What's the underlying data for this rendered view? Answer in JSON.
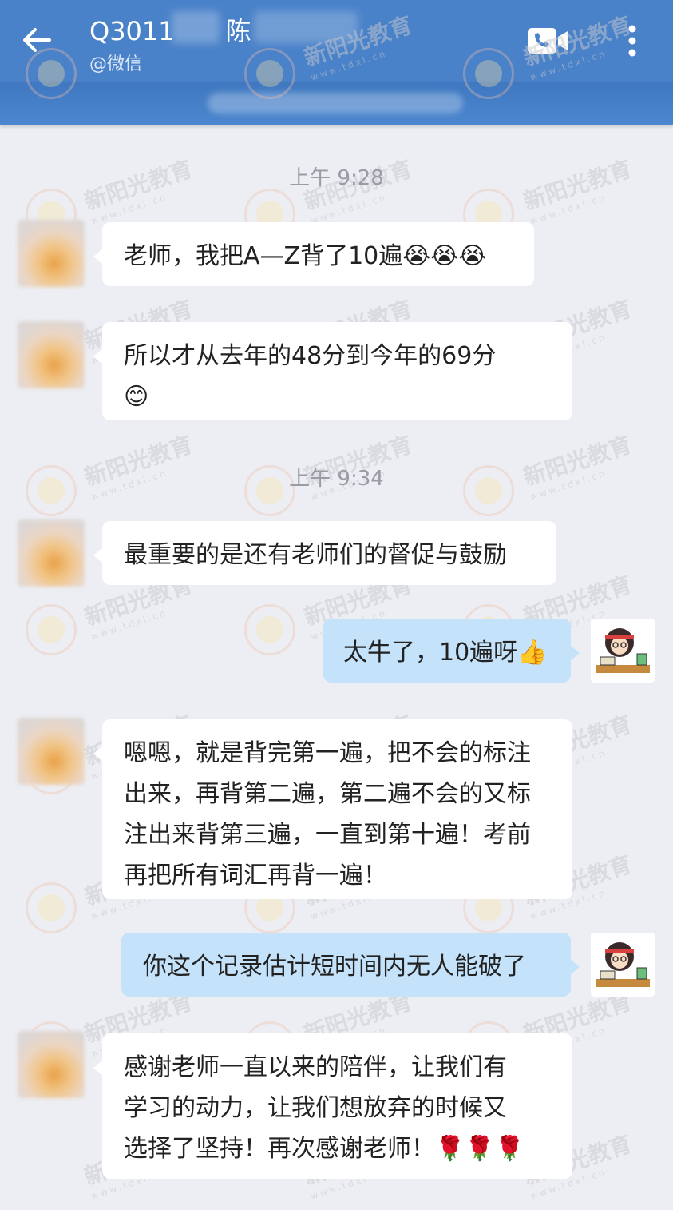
{
  "header": {
    "title": "Q3011",
    "title_suffix": "陈",
    "subtitle": "@微信",
    "back_icon": "arrow-left-icon",
    "call_icon": "video-call-icon",
    "menu_icon": "more-vertical-icon",
    "color": "#4a82c9"
  },
  "watermark": {
    "brand": "新阳光教育",
    "site": "www.tdxl.cn"
  },
  "messages": [
    {
      "type": "time",
      "text": "上午 9:28"
    },
    {
      "type": "msg",
      "side": "left",
      "text": "老师，我把A—Z背了10遍",
      "emoji": "😭😭😭"
    },
    {
      "type": "msg",
      "side": "left",
      "text": "所以才从去年的48分到今年的69分",
      "emoji": "😊"
    },
    {
      "type": "time",
      "text": "上午 9:34"
    },
    {
      "type": "msg",
      "side": "left",
      "text": "最重要的是还有老师们的督促与鼓励"
    },
    {
      "type": "msg",
      "side": "right",
      "text": "太牛了，10遍呀",
      "emoji": "👍"
    },
    {
      "type": "msg",
      "side": "left",
      "lines": [
        "嗯嗯，就是背完第一遍，把不会的标注",
        "出来，再背第二遍，第二遍不会的又标",
        "注出来背第三遍，一直到第十遍！考前",
        "再把所有词汇再背一遍！"
      ]
    },
    {
      "type": "msg",
      "side": "right",
      "text": "你这个记录估计短时间内无人能破了"
    },
    {
      "type": "msg",
      "side": "left",
      "lines": [
        "感谢老师一直以来的陪伴，让我们有",
        "学习的动力，让我们想放弃的时候又",
        "选择了坚持！再次感谢老师！"
      ],
      "emoji": "🌹🌹🌹"
    }
  ]
}
